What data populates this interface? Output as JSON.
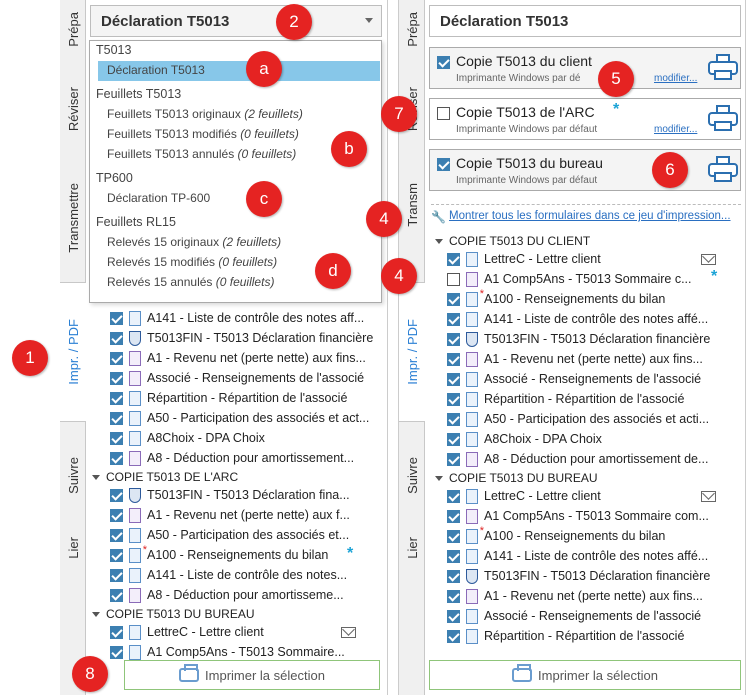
{
  "header": {
    "title": "Déclaration T5013"
  },
  "tabs_left": [
    "Prépa",
    "Réviser",
    "Transmettre",
    "Impr. / PDF",
    "Suivre",
    "Lier"
  ],
  "tabs_right": [
    "Prépa",
    "Réviser",
    "Transm",
    "Impr. / PDF",
    "Suivre",
    "Lier"
  ],
  "dropdown": {
    "groups": [
      {
        "name": "T5013",
        "items": [
          {
            "label": "Déclaration T5013",
            "count": ""
          }
        ]
      },
      {
        "name": "Feuillets T5013",
        "items": [
          {
            "label": "Feuillets T5013 originaux ",
            "count": "(2 feuillets)"
          },
          {
            "label": "Feuillets T5013 modifiés ",
            "count": "(0 feuillets)"
          },
          {
            "label": "Feuillets T5013 annulés ",
            "count": "(0 feuillets)"
          }
        ]
      },
      {
        "name": "TP600",
        "items": [
          {
            "label": "Déclaration TP-600",
            "count": ""
          }
        ]
      },
      {
        "name": "Feuillets RL15",
        "items": [
          {
            "label": "Relevés 15 originaux ",
            "count": "(2 feuillets)"
          },
          {
            "label": "Relevés 15 modifiés ",
            "count": "(0 feuillets)"
          },
          {
            "label": "Relevés 15 annulés ",
            "count": "(0 feuillets)"
          }
        ]
      }
    ]
  },
  "left_list": {
    "rows_top": [
      "A141 - Liste de contrôle des notes aff...",
      "T5013FIN - T5013 Déclaration financière",
      "A1 - Revenu net (perte nette) aux fins...",
      "Associé - Renseignements de l'associé",
      "Répartition - Répartition de l'associé",
      "A50 - Participation des associés et act...",
      "A8Choix - DPA Choix",
      "A8 - Déduction pour amortissement..."
    ],
    "section_arc": "COPIE T5013 DE L'ARC",
    "rows_arc": [
      "T5013FIN - T5013 Déclaration fina...",
      "A1 - Revenu net (perte nette) aux f...",
      "A50 - Participation des associés et...",
      "A100 - Renseignements du bilan",
      "A141 - Liste de contrôle des notes...",
      "A8 - Déduction pour amortisseme..."
    ],
    "section_bureau": "COPIE T5013 DU BUREAU",
    "rows_bureau": [
      "LettreC - Lettre client",
      "A1 Comp5Ans - T5013 Sommaire..."
    ]
  },
  "right": {
    "copies": [
      {
        "title": "Copie T5013 du client",
        "sub": "Imprimante Windows par dé",
        "mod": "modifier..."
      },
      {
        "title": "Copie T5013 de l'ARC",
        "sub": "Imprimante Windows par défaut",
        "mod": "modifier..."
      },
      {
        "title": "Copie T5013 du bureau",
        "sub": "Imprimante Windows par défaut",
        "mod": ""
      }
    ],
    "link": "Montrer tous les formulaires dans ce jeu d'impression...",
    "section_client": "COPIE T5013 DU CLIENT",
    "rows_client": [
      "LettreC - Lettre client",
      "A1 Comp5Ans - T5013 Sommaire c...",
      "A100 - Renseignements du bilan",
      "A141 - Liste de contrôle des notes affé...",
      "T5013FIN - T5013 Déclaration financière",
      "A1 - Revenu net (perte nette) aux fins...",
      "Associé - Renseignements de l'associé",
      "Répartition - Répartition de l'associé",
      "A50 - Participation des associés et acti...",
      "A8Choix - DPA Choix",
      "A8 - Déduction pour amortissement de..."
    ],
    "section_bureau": "COPIE T5013 DU BUREAU",
    "rows_bureau": [
      "LettreC - Lettre client",
      "A1 Comp5Ans - T5013 Sommaire com...",
      "A100 - Renseignements du bilan",
      "A141 - Liste de contrôle des notes affé...",
      "T5013FIN - T5013 Déclaration financière",
      "A1 - Revenu net (perte nette) aux fins...",
      "Associé - Renseignements de l'associé",
      "Répartition - Répartition de l'associé"
    ]
  },
  "print_button": "Imprimer la sélection",
  "callouts": [
    "2",
    "a",
    "b",
    "c",
    "d",
    "1",
    "8",
    "5",
    "7",
    "6",
    "4",
    "4"
  ]
}
